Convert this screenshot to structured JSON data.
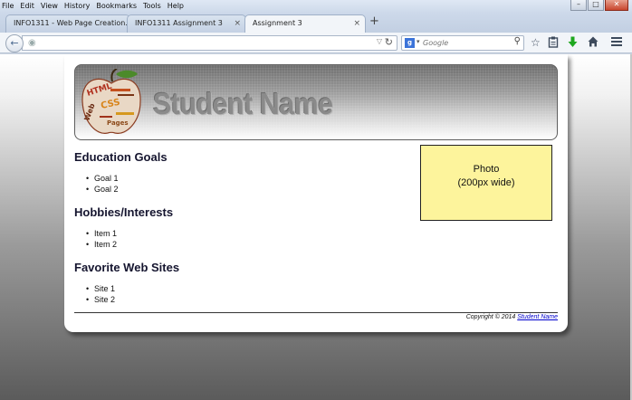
{
  "menu": [
    "File",
    "Edit",
    "View",
    "History",
    "Bookmarks",
    "Tools",
    "Help"
  ],
  "window": {
    "minimize": "–",
    "maximize": "□",
    "close": "✕"
  },
  "tabs": [
    {
      "label": "INFO1311 - Web Page Creation..."
    },
    {
      "label": "INFO1311 Assignment 3"
    },
    {
      "label": "Assignment 3"
    }
  ],
  "tab_close": "×",
  "new_tab": "+",
  "search": {
    "engine_letter": "g",
    "placeholder": "Google"
  },
  "page": {
    "banner_title": "Student Name",
    "apple_words": [
      "HTML",
      "CSS",
      "Web",
      "Pages"
    ],
    "photo_line1": "Photo",
    "photo_line2": "(200px wide)",
    "sections": [
      {
        "title": "Education Goals",
        "items": [
          "Goal 1",
          "Goal 2"
        ]
      },
      {
        "title": "Hobbies/Interests",
        "items": [
          "Item 1",
          "Item 2"
        ]
      },
      {
        "title": "Favorite Web Sites",
        "items": [
          "Site 1",
          "Site 2"
        ]
      }
    ],
    "footer_text": "Copyright © 2014 ",
    "footer_link": "Student Name"
  },
  "colors": {
    "photo_bg": "#fdf49c",
    "heading": "#15152f",
    "link": "#0000cc",
    "install_arrow": "#1fa81f"
  },
  "icons": [
    "back-icon",
    "globe-icon",
    "dropdown-icon",
    "reload-icon",
    "search-icon",
    "star-icon",
    "clipboard-icon",
    "download-icon",
    "home-icon",
    "menu-icon"
  ]
}
